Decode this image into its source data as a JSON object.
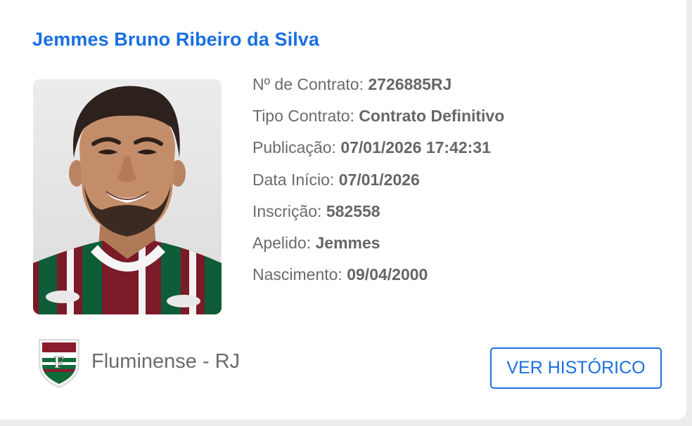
{
  "player": {
    "name": "Jemmes Bruno Ribeiro da Silva",
    "photo_icon": "player-portrait"
  },
  "details": [
    {
      "label": "Nº de Contrato: ",
      "value": "2726885RJ"
    },
    {
      "label": "Tipo Contrato: ",
      "value": "Contrato Definitivo"
    },
    {
      "label": "Publicação: ",
      "value": "07/01/2026 17:42:31"
    },
    {
      "label": "Data Início: ",
      "value": "07/01/2026"
    },
    {
      "label": "Inscrição: ",
      "value": "582558"
    },
    {
      "label": "Apelido: ",
      "value": "Jemmes"
    },
    {
      "label": "Nascimento: ",
      "value": "09/04/2000"
    }
  ],
  "club": {
    "name": "Fluminense - RJ",
    "crest_icon": "fluminense-crest"
  },
  "actions": {
    "history_label": "VER HISTÓRICO"
  },
  "colors": {
    "accent": "#1a6fe0",
    "text": "#6b6b6b",
    "background": "#ededed",
    "card": "#ffffff",
    "club_maroon": "#8c1a2e",
    "club_green": "#0f6b3a"
  }
}
